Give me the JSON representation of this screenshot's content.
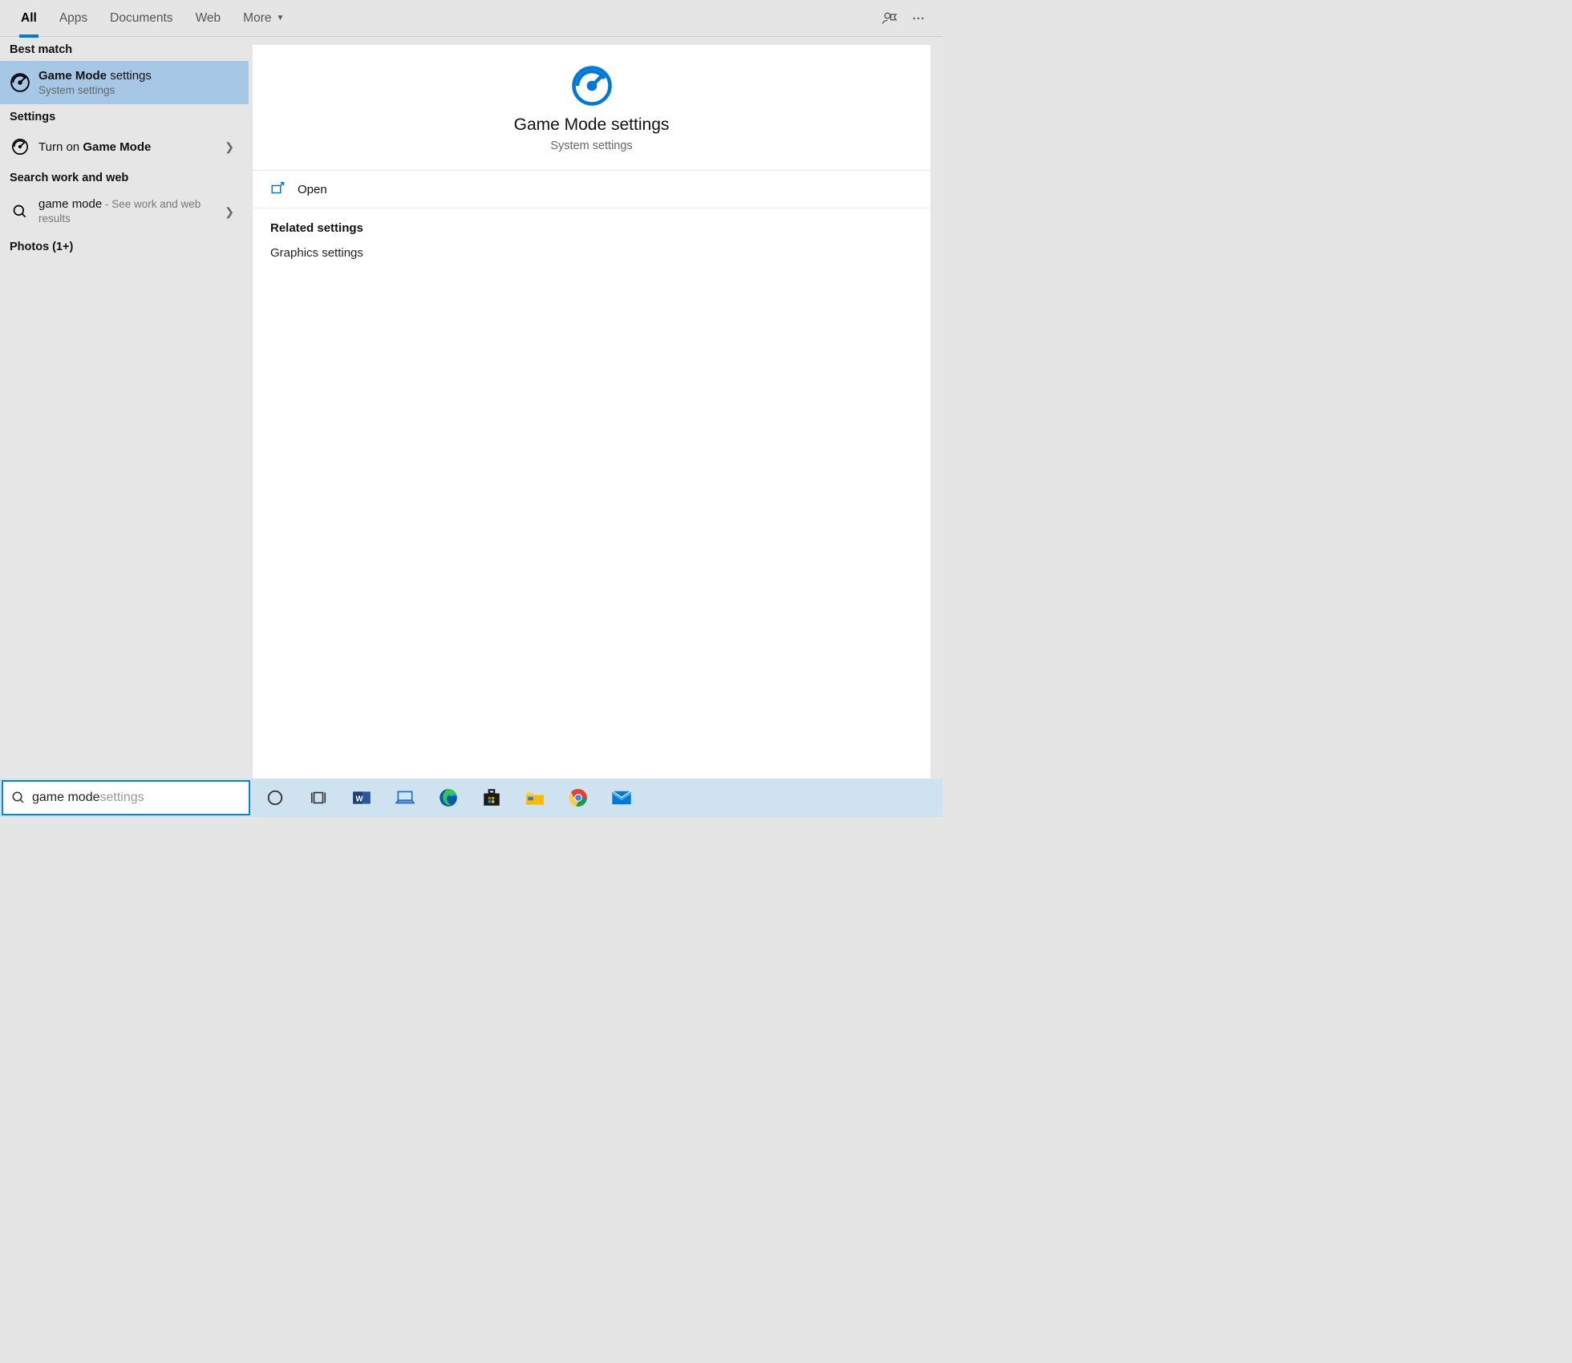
{
  "tabs": {
    "all": "All",
    "apps": "Apps",
    "documents": "Documents",
    "web": "Web",
    "more": "More"
  },
  "left": {
    "best_match_hdr": "Best match",
    "best_match": {
      "prefix": "Game Mode",
      "suffix": " settings",
      "sub": "System settings"
    },
    "settings_hdr": "Settings",
    "turn_on": {
      "prefix": "Turn on ",
      "bold": "Game Mode"
    },
    "work_web_hdr": "Search work and web",
    "work_web": {
      "text": "game mode",
      "suffix": " - See work and web results"
    },
    "photos_hdr": "Photos (1+)"
  },
  "detail": {
    "title": "Game Mode settings",
    "sub": "System settings",
    "open": "Open",
    "related_hdr": "Related settings",
    "graphics": "Graphics settings"
  },
  "search": {
    "typed": "game mode",
    "ghost": " settings"
  }
}
